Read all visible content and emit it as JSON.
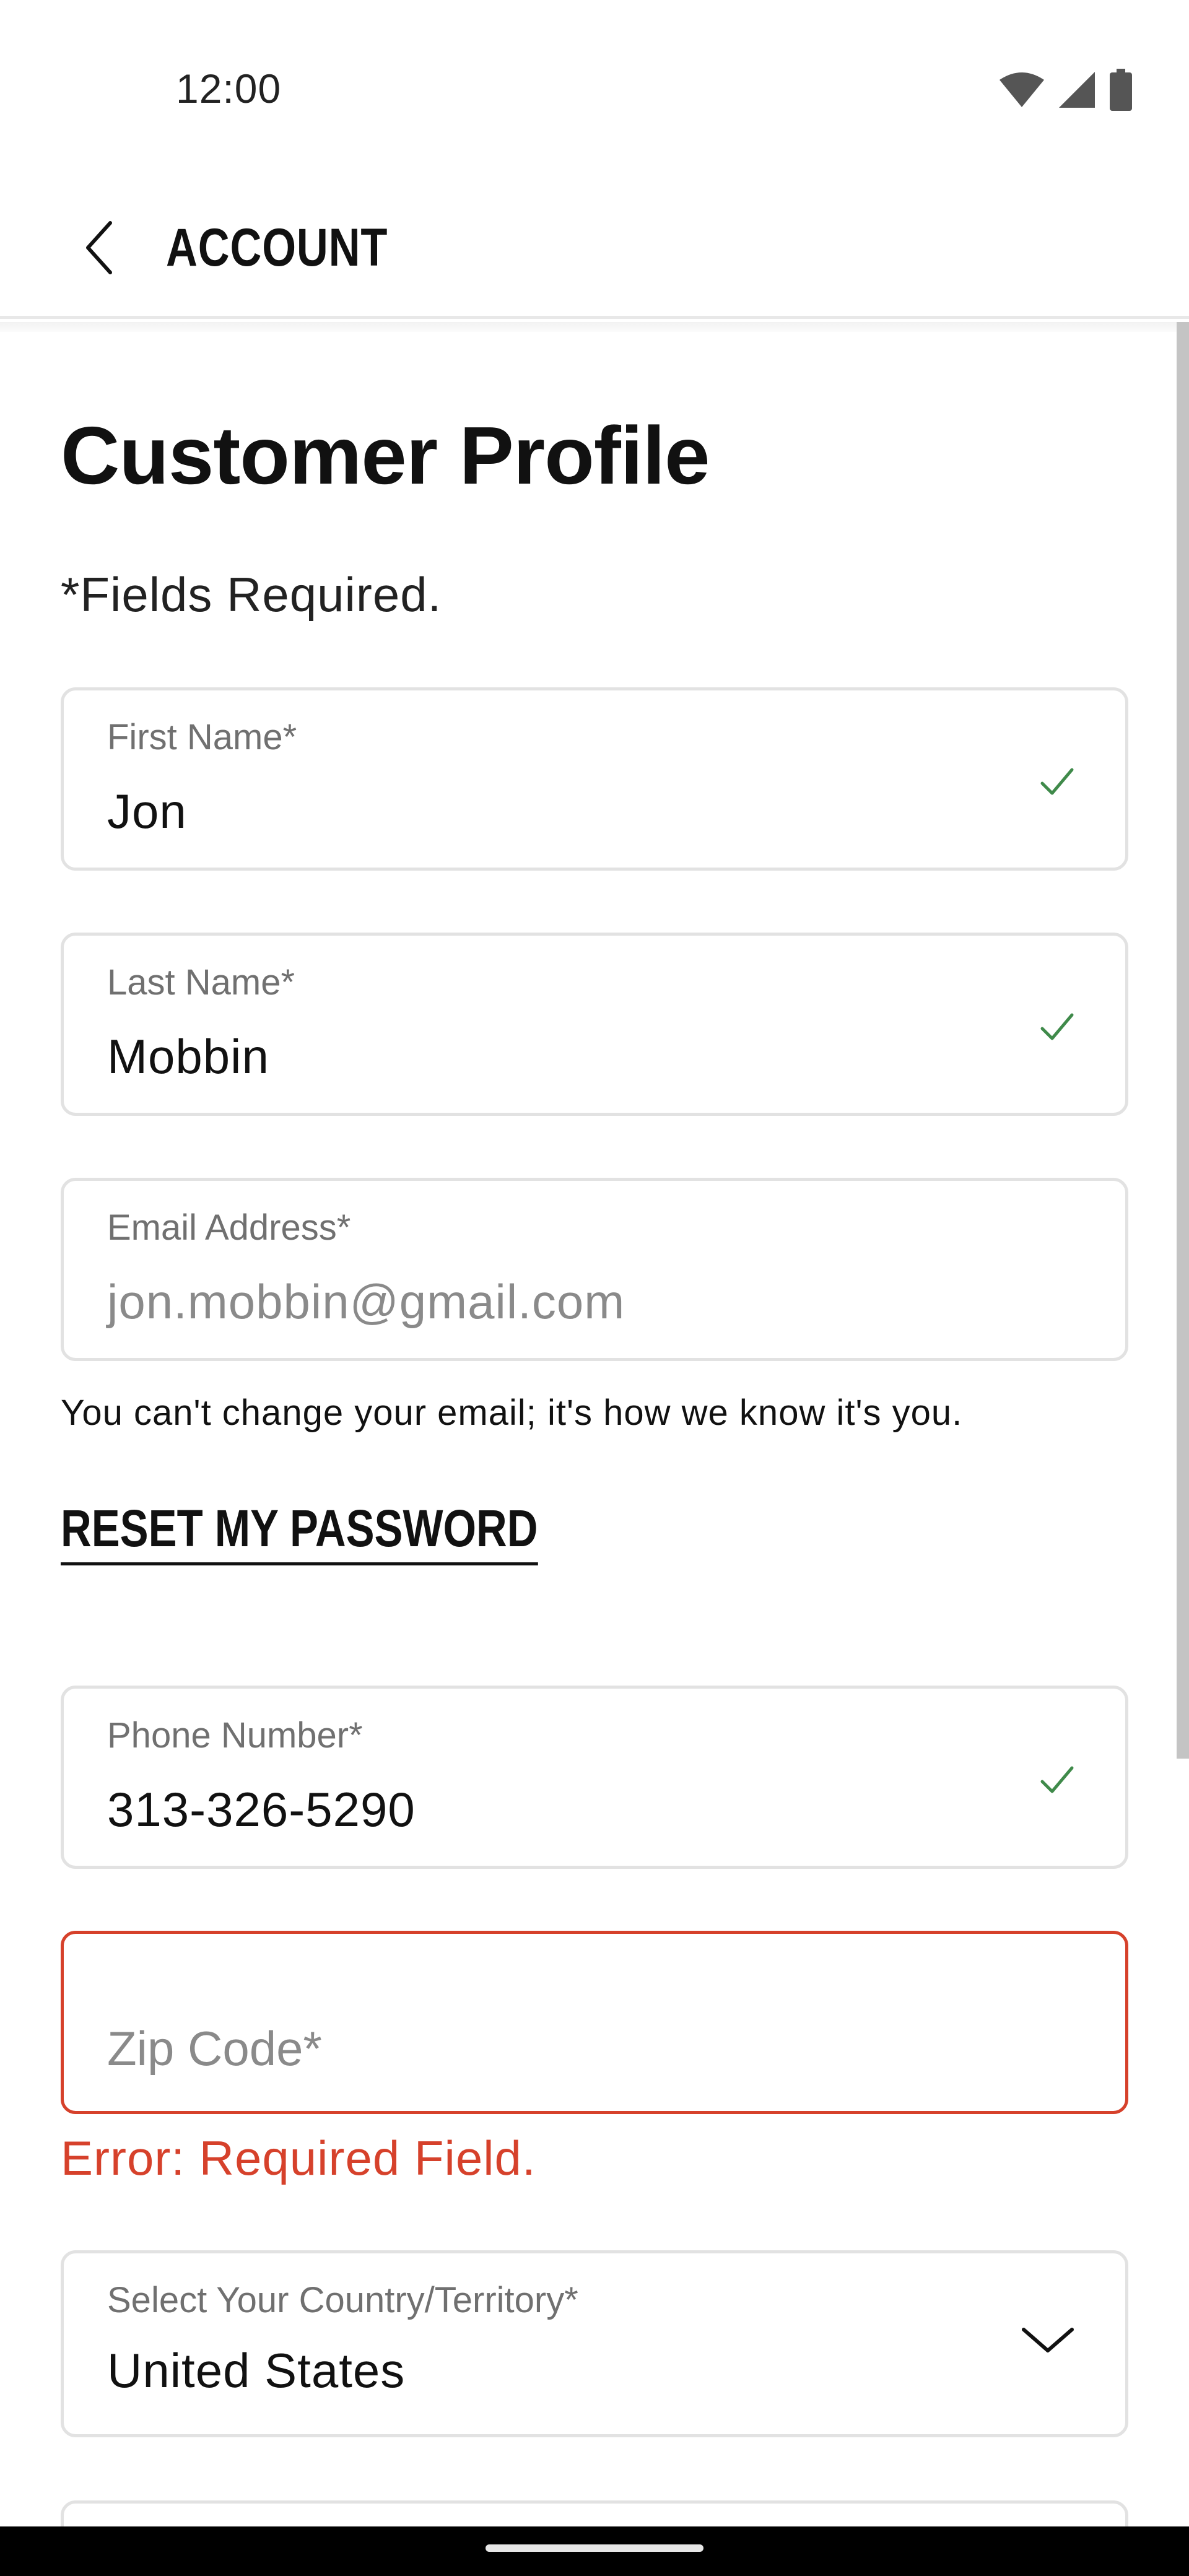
{
  "status_bar": {
    "time": "12:00",
    "icons": [
      "wifi-icon",
      "signal-icon",
      "battery-icon"
    ]
  },
  "app_bar": {
    "back_icon": "chevron-left-icon",
    "title": "ACCOUNT"
  },
  "content": {
    "page_title": "Customer Profile",
    "required_note": "*Fields Required.",
    "fields": {
      "first_name": {
        "label": "First Name*",
        "value": "Jon",
        "valid": true
      },
      "last_name": {
        "label": "Last Name*",
        "value": "Mobbin",
        "valid": true
      },
      "email": {
        "label": "Email Address*",
        "value": "jon.mobbin@gmail.com",
        "disabled": true
      },
      "phone": {
        "label": "Phone Number*",
        "value": "313-326-5290",
        "valid": true
      },
      "zip": {
        "placeholder": "Zip Code*",
        "value": "",
        "error": "Error: Required Field."
      },
      "country": {
        "label": "Select Your Country/Territory*",
        "value": "United States"
      }
    },
    "email_helper": "You can't change your email; it's how we know it's you.",
    "reset_password_label": "RESET MY PASSWORD"
  },
  "colors": {
    "accent_error": "#d6412b",
    "valid_check": "#3f8a4a",
    "border": "#e2e2e2",
    "text": "#111111"
  }
}
